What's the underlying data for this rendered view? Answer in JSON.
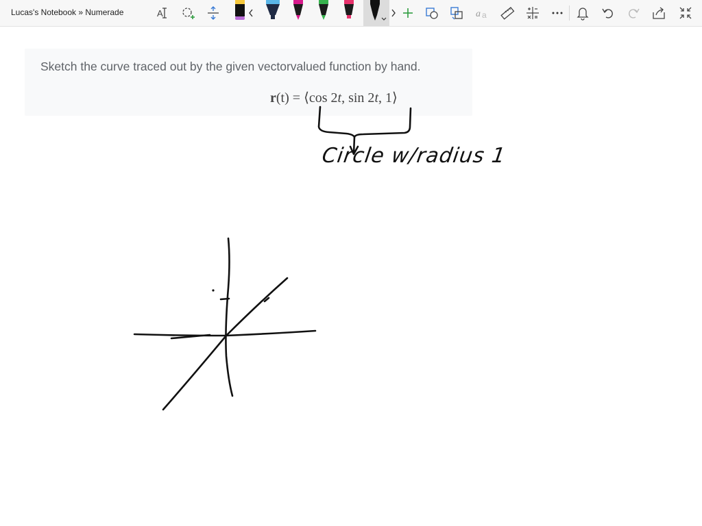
{
  "header": {
    "breadcrumb": "Lucas's Notebook » Numerade"
  },
  "toolbar": {
    "buttons": [
      {
        "name": "text-select-icon"
      },
      {
        "name": "lasso-select-icon"
      },
      {
        "name": "add-space-icon"
      },
      {
        "name": "chevron-left-icon"
      },
      {
        "name": "chevron-right-icon"
      },
      {
        "name": "add-pen-icon"
      },
      {
        "name": "shapes-icon"
      },
      {
        "name": "ink-to-shape-icon"
      },
      {
        "name": "ink-to-text-icon"
      },
      {
        "name": "ruler-icon"
      },
      {
        "name": "math-icon"
      },
      {
        "name": "more-icon"
      },
      {
        "name": "bell-icon"
      },
      {
        "name": "undo-icon"
      },
      {
        "name": "redo-icon"
      },
      {
        "name": "share-icon"
      },
      {
        "name": "fullscreen-icon"
      }
    ],
    "pens": [
      {
        "name": "pen-black-yellow",
        "color": "#111111",
        "accent": "#f6c83c"
      },
      {
        "name": "highlighter-blue",
        "color": "#1f2a44",
        "accent": "#5ab6e8"
      },
      {
        "name": "pen-magenta",
        "color": "#1c1c1c",
        "accent": "#d81b8c"
      },
      {
        "name": "pen-green",
        "color": "#1c1c1c",
        "accent": "#37b24d"
      },
      {
        "name": "pen-pink",
        "color": "#1c1c1c",
        "accent": "#e8336d"
      },
      {
        "name": "pen-black-selected",
        "color": "#111111",
        "accent": "#111111"
      }
    ]
  },
  "question": {
    "prompt": "Sketch the curve traced out by the given vectorvalued function by hand.",
    "equation_lhs_r": "r",
    "equation_lhs_t": "(t)",
    "equation_eq": " = ",
    "equation_rhs_open": "⟨cos 2",
    "equation_rhs_t1": "t",
    "equation_rhs_mid": ", sin 2",
    "equation_rhs_t2": "t",
    "equation_rhs_close": ", 1⟩"
  },
  "ink": {
    "annotation": "Circle w/radius 1",
    "ink_color": "#111111"
  }
}
